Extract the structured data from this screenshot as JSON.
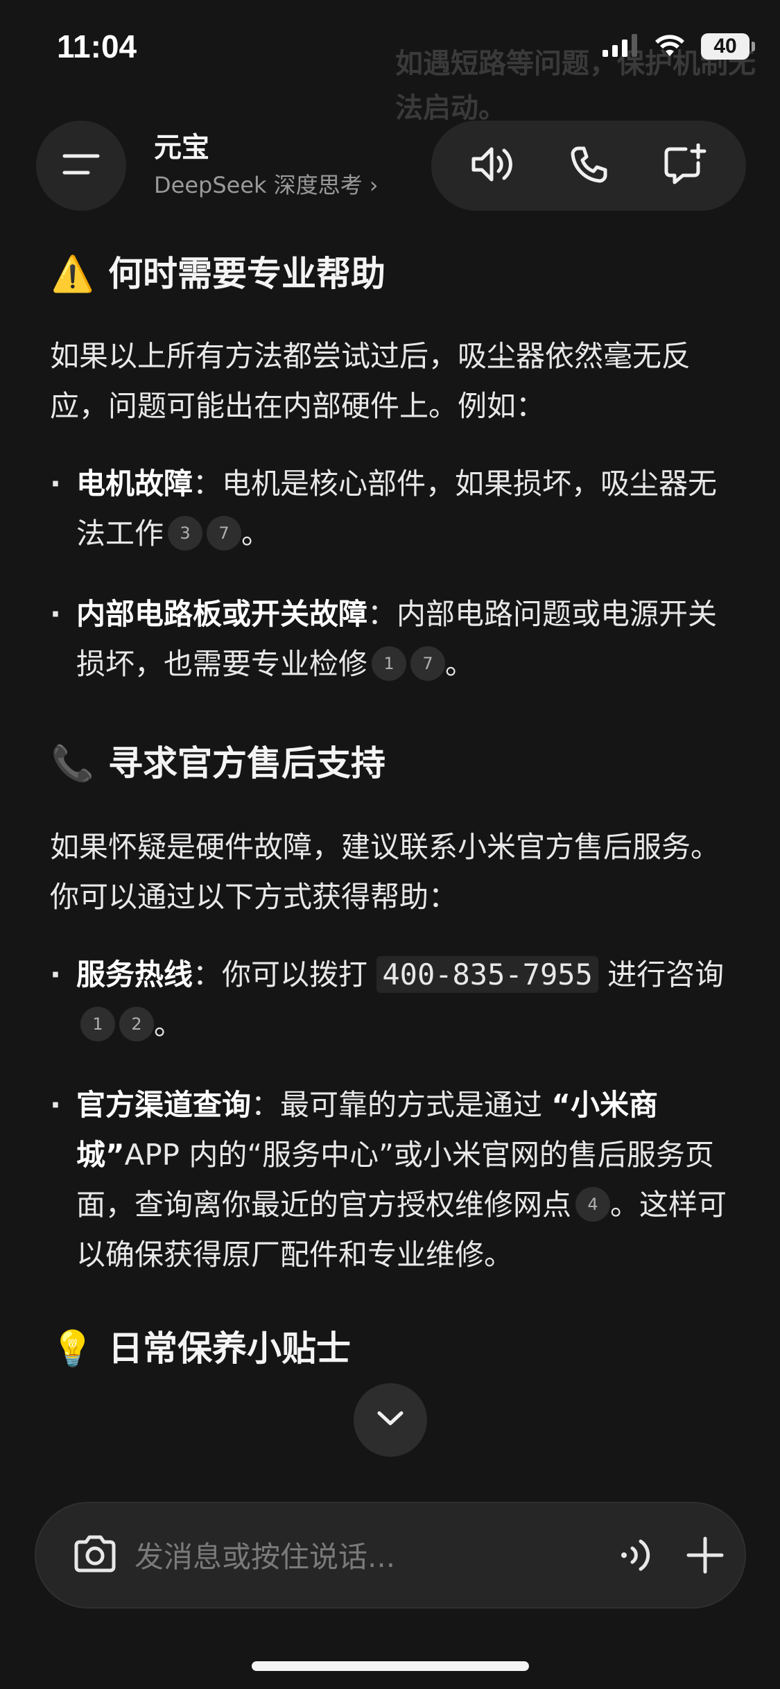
{
  "status_bar": {
    "time": "11:04",
    "battery": "40"
  },
  "ghost_text": "如遇短路等问题，保护机制无法启动。",
  "header": {
    "title": "元宝",
    "subtitle": "DeepSeek 深度思考",
    "subtitle_chevron": "›"
  },
  "content": {
    "section1": {
      "emoji": "⚠️",
      "heading": "何时需要专业帮助",
      "intro": "如果以上所有方法都尝试过后，吸尘器依然毫无反应，问题可能出在内部硬件上。例如：",
      "bullets": [
        {
          "bold": "电机故障",
          "text": "：电机是核心部件，如果损坏，吸尘器无法工作",
          "cites": [
            "3",
            "7"
          ],
          "tail": "。"
        },
        {
          "bold": "内部电路板或开关故障",
          "text": "：内部电路问题或电源开关损坏，也需要专业检修",
          "cites": [
            "1",
            "7"
          ],
          "tail": "。"
        }
      ]
    },
    "section2": {
      "emoji": "📞",
      "heading": "寻求官方售后支持",
      "intro": "如果怀疑是硬件故障，建议联系小米官方售后服务。你可以通过以下方式获得帮助：",
      "bullet1": {
        "bold": "服务热线",
        "text_before": "：你可以拨打 ",
        "phone": "400-835-7955",
        "text_after": " 进行咨询",
        "cites": [
          "1",
          "2"
        ],
        "tail": "。"
      },
      "bullet2": {
        "bold": "官方渠道查询",
        "text_before": "：最可靠的方式是通过 ",
        "bold2": "“小米商城”",
        "text_mid": "APP 内的“服务中心”或小米官网的售后服务页面，查询离你最近的官方授权维修网点",
        "cite": "4",
        "text_after": "。这样可以确保获得原厂配件和专业维修。"
      }
    },
    "section3": {
      "emoji": "💡",
      "heading": "日常保养小贴士"
    }
  },
  "input": {
    "placeholder": "发消息或按住说话..."
  },
  "icons": {
    "menu": "menu-icon",
    "speaker": "speaker-icon",
    "phone": "phone-icon",
    "new_chat": "new-chat-icon",
    "scroll_down": "chevron-down-icon",
    "camera": "camera-icon",
    "voice": "voice-wave-icon",
    "plus": "plus-icon"
  }
}
